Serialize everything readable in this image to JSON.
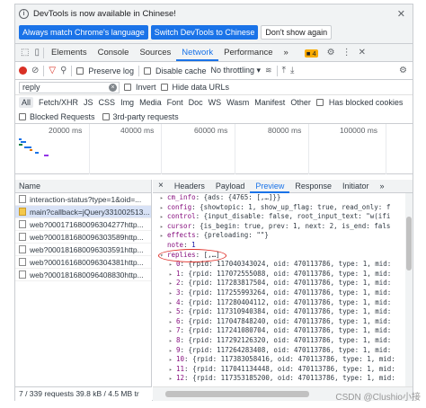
{
  "infobar": {
    "message": "DevTools is now available in Chinese!",
    "buttons": [
      "Always match Chrome's language",
      "Switch DevTools to Chinese",
      "Don't show again"
    ]
  },
  "tabs": {
    "items": [
      "Elements",
      "Console",
      "Sources",
      "Network",
      "Performance"
    ],
    "active": "Network",
    "more": "»",
    "issues_count": "4"
  },
  "toolbar": {
    "preserve_log": "Preserve log",
    "disable_cache": "Disable cache",
    "throttling": "No throttling"
  },
  "filter": {
    "value": "reply",
    "invert": "Invert",
    "hide_data_urls": "Hide data URLs",
    "types": [
      "All",
      "Fetch/XHR",
      "JS",
      "CSS",
      "Img",
      "Media",
      "Font",
      "Doc",
      "WS",
      "Wasm",
      "Manifest",
      "Other"
    ],
    "active_type": "All",
    "has_blocked_cookies": "Has blocked cookies",
    "blocked_requests": "Blocked Requests",
    "third_party": "3rd-party requests"
  },
  "timeline": {
    "ticks": [
      "20000 ms",
      "40000 ms",
      "60000 ms",
      "80000 ms",
      "100000 ms"
    ]
  },
  "requests": {
    "header": "Name",
    "items": [
      "interaction-status?type=1&oid=...",
      "main?callback=jQuery331002513...",
      "web?000171680096304277http...",
      "web?000181680096303589http...",
      "web?000181680096303591http...",
      "web?000161680096304381http...",
      "web?000181680096408830http..."
    ],
    "selected_index": 1,
    "status": "7 / 339 requests   39.8 kB / 4.5 MB tr"
  },
  "details": {
    "close": "×",
    "tabs": [
      "Headers",
      "Payload",
      "Preview",
      "Response",
      "Initiator",
      "»"
    ],
    "active": "Preview",
    "lines": [
      {
        "indent": 1,
        "tri": "▸",
        "key": "cm_info",
        "val": "{ads: {4765: [,…]}}"
      },
      {
        "indent": 1,
        "tri": "▸",
        "key": "config",
        "val": "{showtopic: 1, show_up_flag: true, read_only: f"
      },
      {
        "indent": 1,
        "tri": "▸",
        "key": "control",
        "val": "{input_disable: false, root_input_text: \"w(ifi"
      },
      {
        "indent": 1,
        "tri": "▸",
        "key": "cursor",
        "val": "{is_begin: true, prev: 1, next: 2, is_end: fals"
      },
      {
        "indent": 1,
        "tri": "▸",
        "key": "effects",
        "val": "{preloading: \"\"}"
      },
      {
        "indent": 1,
        "tri": "",
        "key": "note",
        "val": "1"
      },
      {
        "indent": 1,
        "tri": "▾",
        "key": "replies",
        "val": "[,…]"
      },
      {
        "indent": 2,
        "tri": "▸",
        "key": "0",
        "val": "{rpid: 117040343024, oid: 470113786, type: 1, mid:"
      },
      {
        "indent": 2,
        "tri": "▸",
        "key": "1",
        "val": "{rpid: 117072555088, oid: 470113786, type: 1, mid:"
      },
      {
        "indent": 2,
        "tri": "▸",
        "key": "2",
        "val": "{rpid: 117283817504, oid: 470113786, type: 1, mid:"
      },
      {
        "indent": 2,
        "tri": "▸",
        "key": "3",
        "val": "{rpid: 117255993264, oid: 470113786, type: 1, mid:"
      },
      {
        "indent": 2,
        "tri": "▸",
        "key": "4",
        "val": "{rpid: 117280404112, oid: 470113786, type: 1, mid:"
      },
      {
        "indent": 2,
        "tri": "▸",
        "key": "5",
        "val": "{rpid: 117310940384, oid: 470113786, type: 1, mid:"
      },
      {
        "indent": 2,
        "tri": "▸",
        "key": "6",
        "val": "{rpid: 117047848240, oid: 470113786, type: 1, mid:"
      },
      {
        "indent": 2,
        "tri": "▸",
        "key": "7",
        "val": "{rpid: 117241080704, oid: 470113786, type: 1, mid:"
      },
      {
        "indent": 2,
        "tri": "▸",
        "key": "8",
        "val": "{rpid: 117292126320, oid: 470113786, type: 1, mid:"
      },
      {
        "indent": 2,
        "tri": "▸",
        "key": "9",
        "val": "{rpid: 117264283408, oid: 470113786, type: 1, mid:"
      },
      {
        "indent": 2,
        "tri": "▸",
        "key": "10",
        "val": "{rpid: 117383058416, oid: 470113786, type: 1, mid:"
      },
      {
        "indent": 2,
        "tri": "▸",
        "key": "11",
        "val": "{rpid: 117041134448, oid: 470113786, type: 1, mid:"
      },
      {
        "indent": 2,
        "tri": "▸",
        "key": "12",
        "val": "{rpid: 117353185200, oid: 470113786, type: 1, mid:"
      }
    ]
  },
  "watermark": "CSDN @Clushio小接"
}
